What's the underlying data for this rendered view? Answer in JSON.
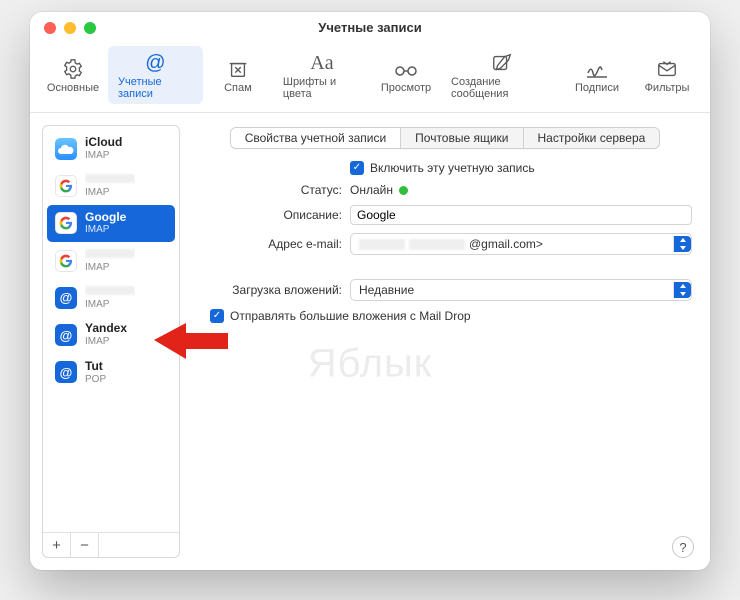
{
  "window_title": "Учетные записи",
  "toolbar": [
    {
      "label": "Основные"
    },
    {
      "label": "Учетные записи"
    },
    {
      "label": "Спам"
    },
    {
      "label": "Шрифты и цвета"
    },
    {
      "label": "Просмотр"
    },
    {
      "label": "Создание сообщения"
    },
    {
      "label": "Подписи"
    },
    {
      "label": "Фильтры"
    }
  ],
  "accounts": [
    {
      "name": "iCloud",
      "proto": "IMAP",
      "icon": "icloud"
    },
    {
      "name": "",
      "proto": "IMAP",
      "icon": "google"
    },
    {
      "name": "Google",
      "proto": "IMAP",
      "icon": "google",
      "selected": true
    },
    {
      "name": "",
      "proto": "IMAP",
      "icon": "google"
    },
    {
      "name": "",
      "proto": "IMAP",
      "icon": "generic"
    },
    {
      "name": "Yandex",
      "proto": "IMAP",
      "icon": "generic"
    },
    {
      "name": "Tut",
      "proto": "POP",
      "icon": "generic"
    }
  ],
  "sidebar_footer": {
    "add": "+",
    "remove": "−"
  },
  "segments": {
    "a": "Свойства учетной записи",
    "b": "Почтовые ящики",
    "c": "Настройки сервера"
  },
  "form": {
    "enable_label": "Включить эту учетную запись",
    "status_label": "Статус:",
    "status_value": "Онлайн",
    "desc_label": "Описание:",
    "desc_value": "Google",
    "email_label": "Адрес e-mail:",
    "email_suffix": "@gmail.com>",
    "attach_label": "Загрузка вложений:",
    "attach_value": "Недавние",
    "maildrop_label": "Отправлять большие вложения с Mail Drop"
  },
  "watermark": "Яблык",
  "help": "?"
}
